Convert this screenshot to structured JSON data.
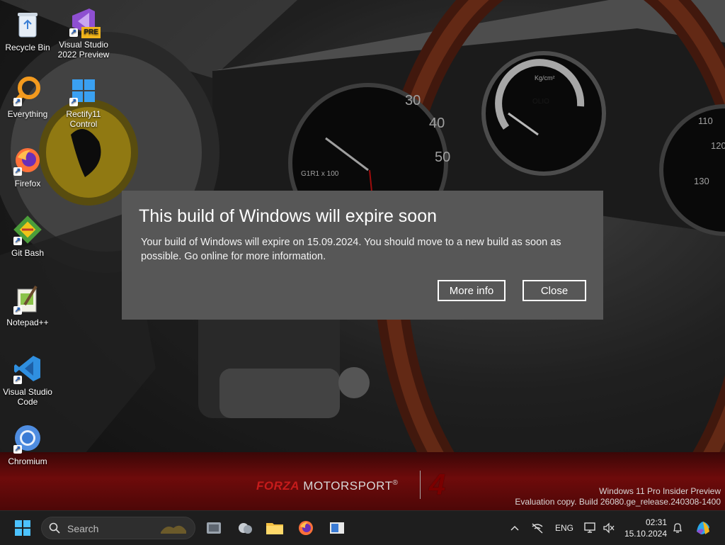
{
  "desktop": {
    "icons": [
      {
        "label": "Recycle Bin",
        "icon": "recycle-bin-icon"
      },
      {
        "label": "Visual Studio 2022 Preview",
        "icon": "visual-studio-preview-icon",
        "badge": "PRE"
      },
      {
        "label": "Everything",
        "icon": "everything-search-icon"
      },
      {
        "label": "Rectify11 Control",
        "icon": "rectify11-control-icon"
      },
      {
        "label": "Firefox",
        "icon": "firefox-icon"
      },
      {
        "label": "Git Bash",
        "icon": "git-bash-icon"
      },
      {
        "label": "Notepad++",
        "icon": "notepad-plus-plus-icon"
      },
      {
        "label": "Visual Studio Code",
        "icon": "vscode-icon"
      },
      {
        "label": "Chromium",
        "icon": "chromium-icon"
      }
    ]
  },
  "wallpaper": {
    "brand_forza": "FORZA",
    "brand_motorsport": "MOTORSPORT",
    "brand_trademark": "®",
    "brand_number": "4",
    "gauge_labels": [
      "30",
      "40",
      "50",
      "G1R1 x 100",
      "Kg/cm²",
      "OLIO",
      "110",
      "120",
      "130"
    ],
    "accent_red": "#6e0b0b"
  },
  "watermark": {
    "line1": "Windows 11 Pro Insider Preview",
    "line2": "Evaluation copy. Build 26080.ge_release.240308-1400"
  },
  "dialog": {
    "title": "This build of Windows will expire soon",
    "body": "Your build of Windows will expire on 15.09.2024. You should move to a new build as soon as possible. Go online for more information.",
    "more_info_label": "More info",
    "close_label": "Close",
    "background": "#575757"
  },
  "taskbar": {
    "search_placeholder": "Search",
    "pinned": [
      "start-icon",
      "task-view-icon",
      "widgets-weather-icon",
      "file-explorer-icon",
      "firefox-icon",
      "app-window-icon"
    ],
    "tray": {
      "language": "ENG",
      "time": "02:31",
      "date": "15.10.2024"
    }
  }
}
